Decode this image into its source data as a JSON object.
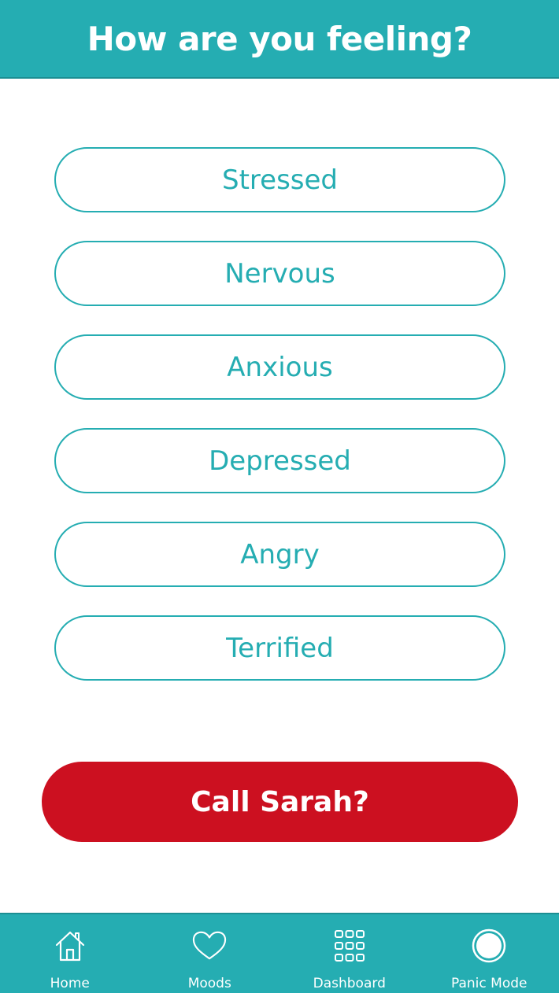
{
  "header": {
    "title": "How are you feeling?"
  },
  "moods": [
    {
      "label": "Stressed"
    },
    {
      "label": "Nervous"
    },
    {
      "label": "Anxious"
    },
    {
      "label": "Depressed"
    },
    {
      "label": "Angry"
    },
    {
      "label": "Terrified"
    }
  ],
  "call_button": {
    "label": "Call Sarah?"
  },
  "tabbar": {
    "items": [
      {
        "label": "Home",
        "icon": "home-icon"
      },
      {
        "label": "Moods",
        "icon": "heart-icon"
      },
      {
        "label": "Dashboard",
        "icon": "grid-icon"
      },
      {
        "label": "Panic Mode",
        "icon": "circle-icon"
      }
    ]
  },
  "colors": {
    "accent": "#25adb2",
    "alert": "#cc1020",
    "background": "#ffffff"
  }
}
